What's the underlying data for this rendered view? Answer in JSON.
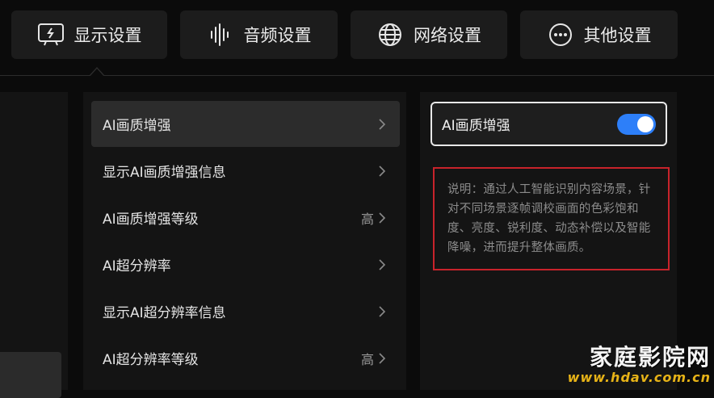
{
  "tabs": [
    {
      "label": "显示设置",
      "icon": "display-settings-icon"
    },
    {
      "label": "音频设置",
      "icon": "audio-waveform-icon"
    },
    {
      "label": "网络设置",
      "icon": "globe-icon"
    },
    {
      "label": "其他设置",
      "icon": "more-dots-icon"
    }
  ],
  "menu": {
    "items": [
      {
        "label": "AI画质增强",
        "value": ""
      },
      {
        "label": "显示AI画质增强信息",
        "value": ""
      },
      {
        "label": "AI画质增强等级",
        "value": "高"
      },
      {
        "label": "AI超分辨率",
        "value": ""
      },
      {
        "label": "显示AI超分辨率信息",
        "value": ""
      },
      {
        "label": "AI超分辨率等级",
        "value": "高"
      }
    ]
  },
  "detail": {
    "toggle_label": "AI画质增强",
    "toggle_on": true,
    "description": "说明：通过人工智能识别内容场景，针对不同场景逐帧调校画面的色彩饱和度、亮度、锐利度、动态补偿以及智能降噪，进而提升整体画质。"
  },
  "watermark": {
    "title": "家庭影院网",
    "url": "www.hdav.com.cn"
  },
  "colors": {
    "accent": "#2d7ff9",
    "highlight_border": "#c8232b",
    "watermark_url": "#e7b317"
  }
}
